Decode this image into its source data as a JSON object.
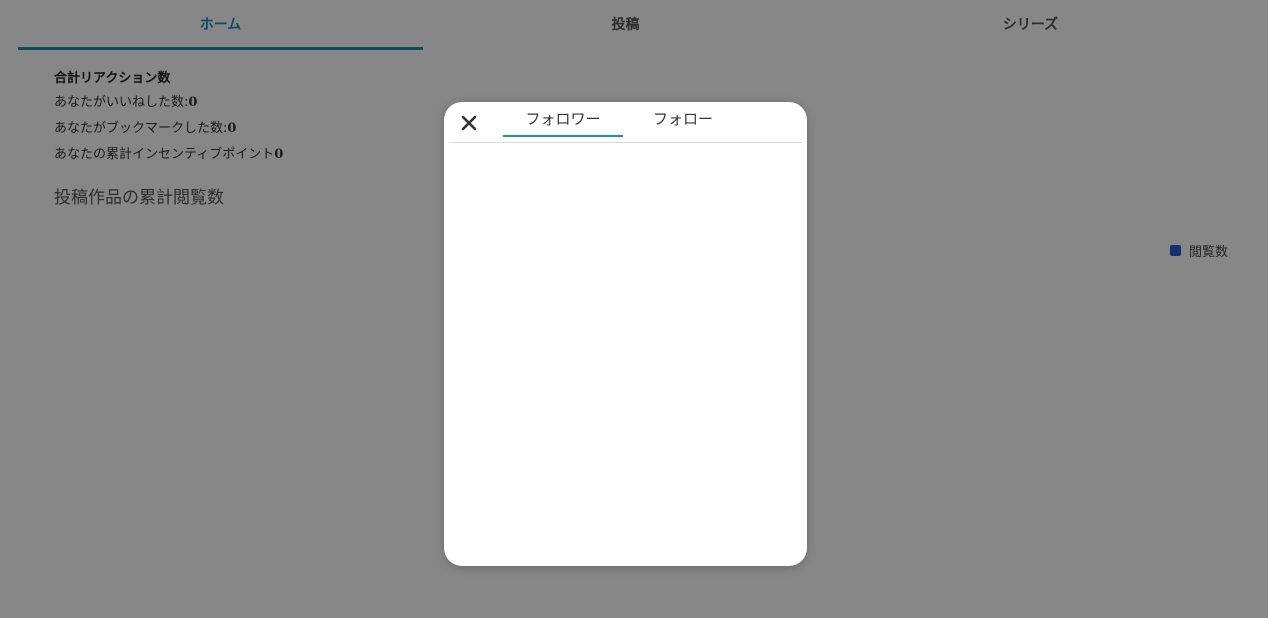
{
  "tabs": [
    {
      "label": "ホーム",
      "active": true
    },
    {
      "label": "投稿",
      "active": false
    },
    {
      "label": "シリーズ",
      "active": false
    }
  ],
  "stats": {
    "title": "合計リアクション数",
    "likes_label": "あなたがいいねした数:",
    "likes_value": "0",
    "bookmarks_label": "あなたがブックマークした数:",
    "bookmarks_value": "0",
    "points_label": "あなたの累計インセンティブポイント",
    "points_value": "0"
  },
  "views": {
    "title": "投稿作品の累計閲覧数",
    "legend_label": "閲覧数",
    "legend_color": "#2a5bd7"
  },
  "modal": {
    "close_icon": "close-icon",
    "tabs": [
      {
        "label": "フォロワー",
        "active": true
      },
      {
        "label": "フォロー",
        "active": false
      }
    ]
  },
  "colors": {
    "accent": "#1a8fb8",
    "overlay": "rgba(0,0,0,0.47)"
  }
}
